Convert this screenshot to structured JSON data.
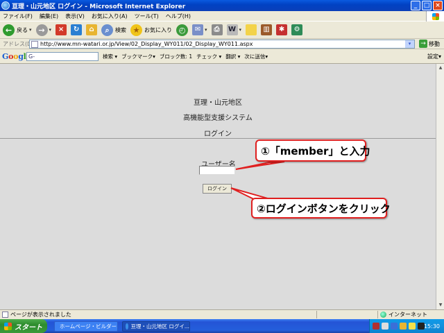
{
  "window": {
    "title": "亘理・山元地区 ログイン - Microsoft Internet Explorer",
    "controls": [
      "_",
      "□",
      "×"
    ]
  },
  "menu": [
    "ファイル(F)",
    "編集(E)",
    "表示(V)",
    "お気に入り(A)",
    "ツール(T)",
    "ヘルプ(H)"
  ],
  "toolbar": {
    "back_label": "戻る",
    "search_label": "検索",
    "favorites_label": "お気に入り"
  },
  "address": {
    "label": "アドレス(D)",
    "url": "http://www.mn-watari.or.jp/View/02_Display_WY011/02_Display_WY011.aspx",
    "go_label": "移動"
  },
  "google_bar": {
    "logo": "Google",
    "search_value": "G-",
    "search_btn": "検索 ▾",
    "bookmarks": "ブックマーク▾",
    "block_count": "ブロック数: 1",
    "check": "チェック ▾",
    "translate": "翻訳 ▾",
    "send_to": "次に送信▾",
    "settings": "設定▾"
  },
  "page": {
    "heading1": "亘理・山元地区",
    "heading2": "高機能型支援システム",
    "heading3": "ログイン",
    "username_label": "ユーザー名",
    "username_value": "",
    "login_button": "ログイン"
  },
  "callouts": {
    "step1": "①「member」と入力",
    "step2": "②ログインボタンをクリック"
  },
  "status": {
    "left": "ページが表示されました",
    "zone": "インターネット"
  },
  "taskbar": {
    "start": "スタート",
    "task1": "ホームページ・ビルダー...",
    "task2": "亘理・山元地区 ログイ...",
    "clock": "15:30"
  }
}
